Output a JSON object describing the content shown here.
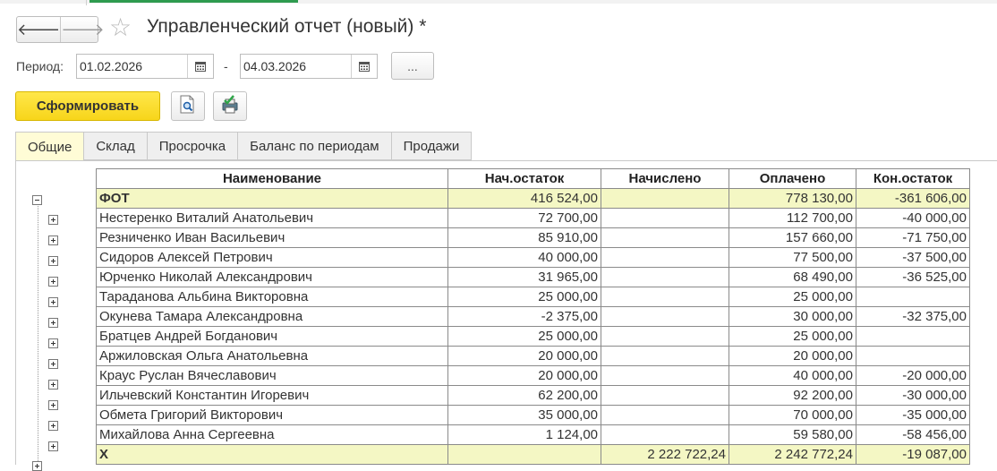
{
  "header": {
    "back_arrow": "🡐",
    "forward_arrow": "🡒",
    "star": "☆",
    "title": "Управленческий отчет (новый) *"
  },
  "period": {
    "label": "Период:",
    "from": "01.02.2026",
    "dash": "-",
    "to": "04.03.2026",
    "more_button": "..."
  },
  "toolbar": {
    "generate_label": "Сформировать"
  },
  "tabs": [
    {
      "label": "Общие",
      "active": true
    },
    {
      "label": "Склад"
    },
    {
      "label": "Просрочка"
    },
    {
      "label": "Баланс по периодам"
    },
    {
      "label": "Продажи"
    }
  ],
  "report": {
    "columns": [
      "Наименование",
      "Нач.остаток",
      "Начислено",
      "Оплачено",
      "Кон.остаток"
    ],
    "group": {
      "name": "ФОТ",
      "start": "416 524,00",
      "accrued": "",
      "paid": "778 130,00",
      "end": "-361 606,00"
    },
    "rows": [
      {
        "name": "Нестеренко Виталий Анатольевич",
        "start": "72 700,00",
        "accrued": "",
        "paid": "112 700,00",
        "end": "-40 000,00"
      },
      {
        "name": "Резниченко Иван Васильевич",
        "start": "85 910,00",
        "accrued": "",
        "paid": "157 660,00",
        "end": "-71 750,00"
      },
      {
        "name": "Сидоров Алексей Петрович",
        "start": "40 000,00",
        "accrued": "",
        "paid": "77 500,00",
        "end": "-37 500,00"
      },
      {
        "name": "Юрченко Николай Александрович",
        "start": "31 965,00",
        "accrued": "",
        "paid": "68 490,00",
        "end": "-36 525,00"
      },
      {
        "name": "Тараданова Альбина Викторовна",
        "start": "25 000,00",
        "accrued": "",
        "paid": "25 000,00",
        "end": ""
      },
      {
        "name": "Окунева Тамара Александровна",
        "start": "-2 375,00",
        "accrued": "",
        "paid": "30 000,00",
        "end": "-32 375,00"
      },
      {
        "name": "Братцев Андрей Богданович",
        "start": "25 000,00",
        "accrued": "",
        "paid": "25 000,00",
        "end": ""
      },
      {
        "name": "Аржиловская Ольга Анатольевна",
        "start": "20 000,00",
        "accrued": "",
        "paid": "20 000,00",
        "end": ""
      },
      {
        "name": "Краус Руслан Вячеславович",
        "start": "20 000,00",
        "accrued": "",
        "paid": "40 000,00",
        "end": "-20 000,00"
      },
      {
        "name": "Ильчевский Константин Игоревич",
        "start": "62 200,00",
        "accrued": "",
        "paid": "92 200,00",
        "end": "-30 000,00"
      },
      {
        "name": "Обмета Григорий Викторович",
        "start": "35 000,00",
        "accrued": "",
        "paid": "70 000,00",
        "end": "-35 000,00"
      },
      {
        "name": "Михайлова Анна Сергеевна",
        "start": "1 124,00",
        "accrued": "",
        "paid": "59 580,00",
        "end": "-58 456,00"
      }
    ],
    "partial_row": {
      "name": "Х",
      "start": "",
      "accrued": "2 222 722,24",
      "paid": "2 242 772,24",
      "end": "-19 087,00"
    }
  },
  "colors": {
    "accent_yellow": "#f7d51a",
    "group_row_bg": "#f4f7c4",
    "active_tab_bg": "#fffcd6",
    "top_green": "#2e9b4f"
  }
}
